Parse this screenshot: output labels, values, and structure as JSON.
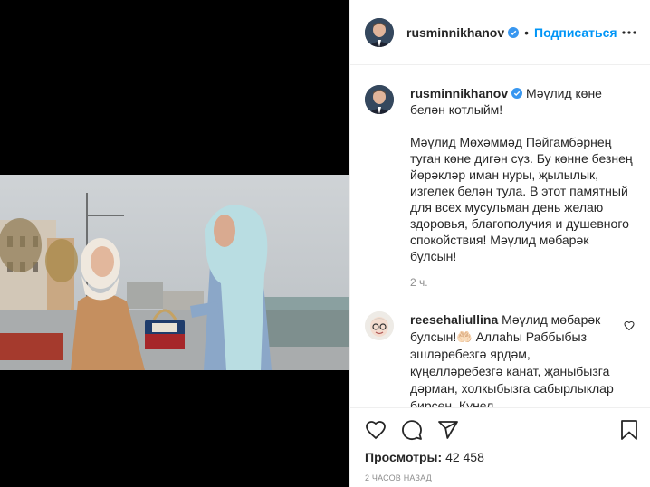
{
  "header": {
    "username": "rusminnikhanov",
    "verified_icon": "verified-badge-icon",
    "separator": "•",
    "follow_label": "Подписаться",
    "more_icon": "more-options-icon"
  },
  "caption": {
    "username": "rusminnikhanov",
    "text": "Мәүлид көне белән котлыйм!\n\nМәүлид Мөхәммәд Пәйгамбәрнең туган көне дигән сүз. Бу көнне безнең йөрәкләр иман нуры, җылылык, изгелек белән тула. В этот памятный для всех мусульман день желаю здоровья, благополучия и душевного спокойствия! Мәүлид мөбарәк булсын!",
    "time": "2 ч."
  },
  "comment": {
    "username": "reesehaliullina",
    "text": "Мәүлид мөбарәк булсын!🤲🏻 Аллаһы Раббыбыз эшләребезгә ярдәм, күңелләребезгә канат, җаныбызга дәрман, холкыбызга сабырлыклар бирсен. Күңел",
    "like_icon": "heart-outline-icon"
  },
  "actions": {
    "icons": [
      "like-icon",
      "comment-icon",
      "share-icon",
      "save-icon"
    ],
    "views_label": "Просмотры:",
    "views_count": "42 458",
    "posted_ago": "2 ЧАСОВ НАЗАД"
  },
  "colors": {
    "accent": "#0095f6",
    "verified": "#3897f0",
    "text": "#262626",
    "muted": "#8e8e8e",
    "border": "#efefef"
  }
}
